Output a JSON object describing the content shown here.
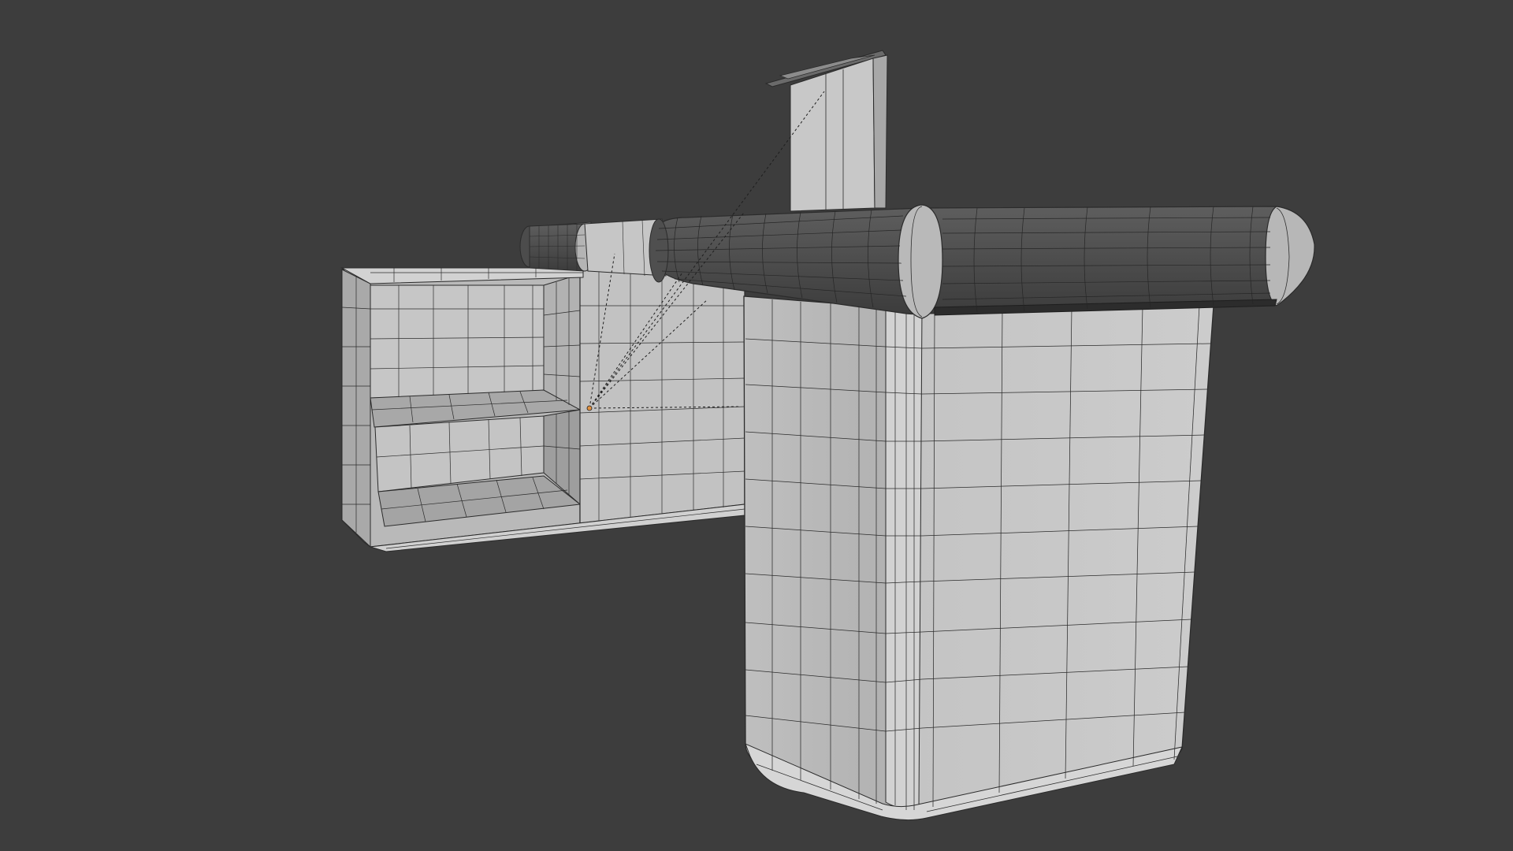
{
  "viewport": {
    "background": "#3d3d3d",
    "shading": "solid",
    "overlay": "wireframe"
  },
  "colors": {
    "light_face": "#c9c9c9",
    "light_face_alt": "#bdbdbd",
    "shadow_face": "#a9a9a9",
    "dark_face": "#4a4a4a",
    "dark_face_light": "#5c5c5c",
    "wire": "#2b2b2b",
    "relationship_line": "#1e1e1e",
    "origin": "#e09040"
  },
  "objects": [
    {
      "name": "left-cabinet",
      "icon": "mesh-icon"
    },
    {
      "name": "front-pedestal",
      "icon": "mesh-icon"
    },
    {
      "name": "countertop-bumper",
      "icon": "mesh-icon"
    },
    {
      "name": "back-bumper",
      "icon": "mesh-icon"
    },
    {
      "name": "sign-post",
      "icon": "mesh-icon"
    },
    {
      "name": "object-origin",
      "icon": "origin-icon"
    }
  ]
}
